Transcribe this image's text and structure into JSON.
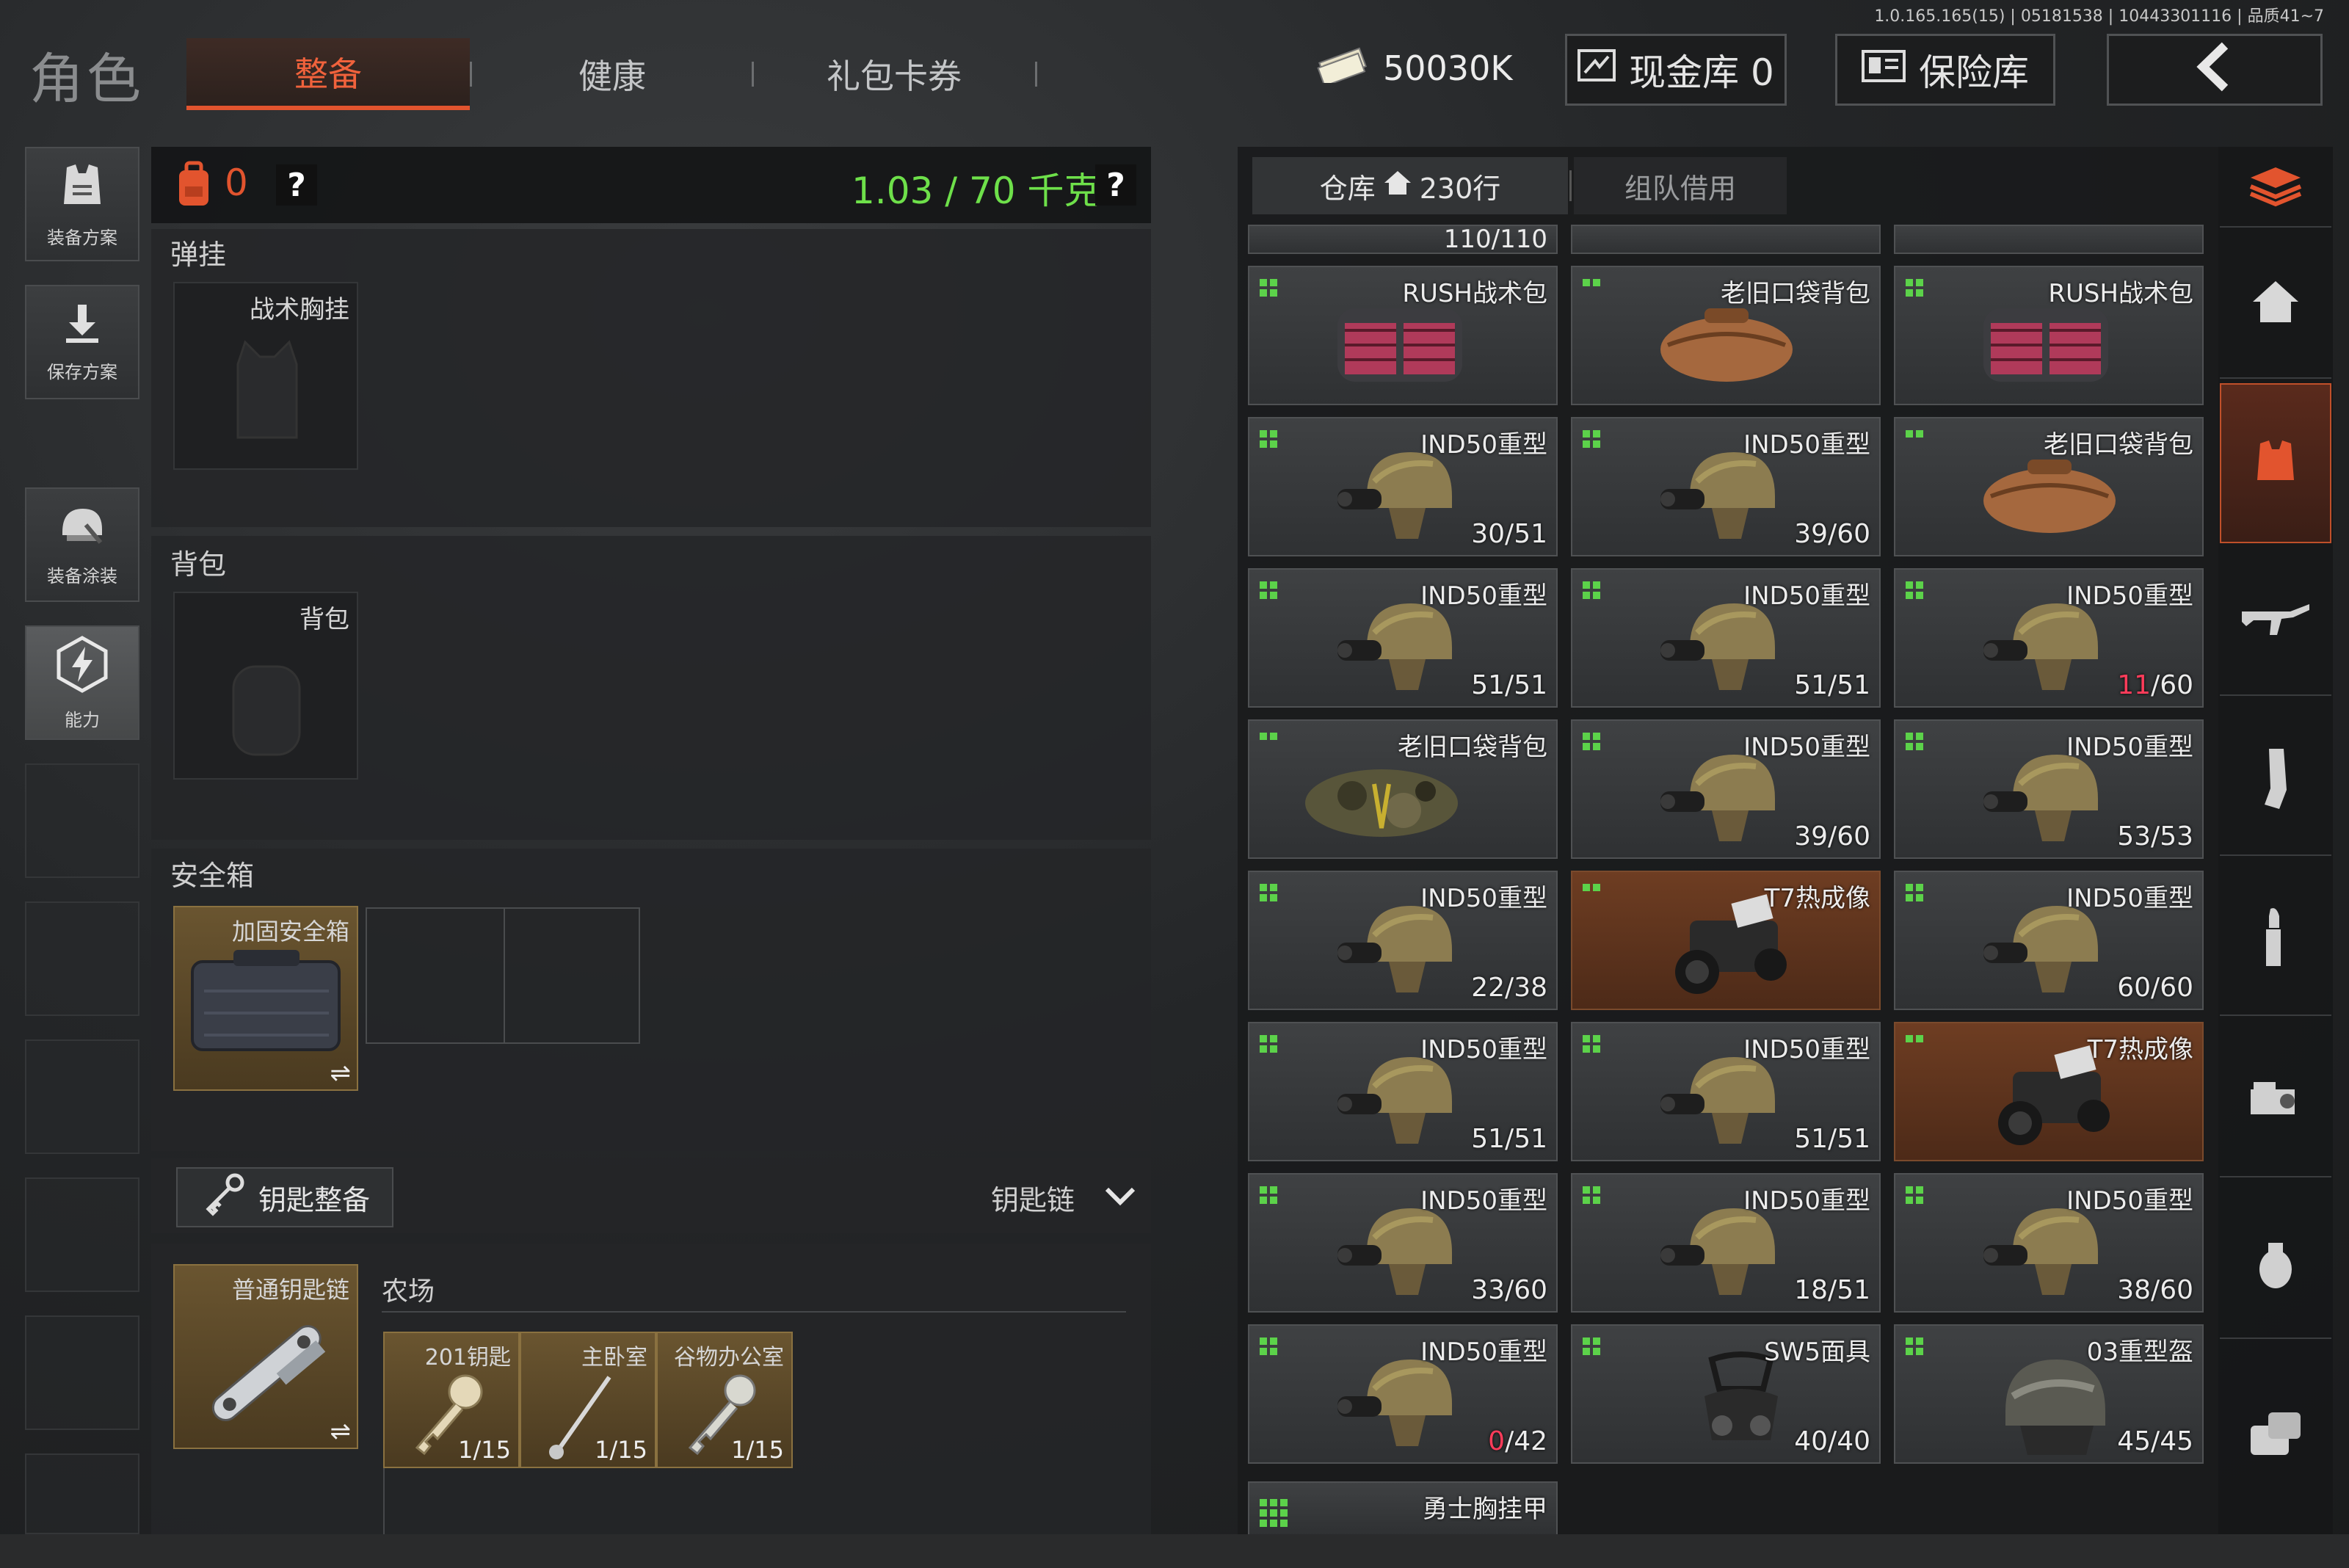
{
  "version": "1.0.165.165(15) | 05181538 | 10443301116 | 品质41~7",
  "header": {
    "title": "角色",
    "tabs": [
      {
        "label": "整备",
        "active": true
      },
      {
        "label": "健康",
        "active": false
      },
      {
        "label": "礼包卡券",
        "active": false
      }
    ],
    "money": "50030K",
    "cash_vault": "现金库 0",
    "safe_vault": "保险库",
    "back": "‹"
  },
  "sidebar": {
    "items": [
      {
        "label": "装备方案",
        "icon": "vest-icon"
      },
      {
        "label": "保存方案",
        "icon": "download-icon"
      },
      {
        "label": "装备涂装",
        "icon": "helmet-paint-icon"
      },
      {
        "label": "能力",
        "icon": "ability-icon"
      }
    ]
  },
  "loadout": {
    "backpack_count": "0",
    "help": "?",
    "weight": "1.03 / 70 千克",
    "weight_help": "?",
    "chest_rig": {
      "section": "弹挂",
      "slot_label": "战术胸挂"
    },
    "backpack": {
      "section": "背包",
      "slot_label": "背包"
    },
    "safebox": {
      "section": "安全箱",
      "item": "加固安全箱",
      "swap": "⇌"
    },
    "keys": {
      "button": "钥匙整备",
      "dropdown": "钥匙链",
      "chain_item": "普通钥匙链",
      "swap": "⇌",
      "area": "农场",
      "key_items": [
        {
          "name": "201钥匙",
          "count": "1/15"
        },
        {
          "name": "主卧室",
          "count": "1/15"
        },
        {
          "name": "谷物办公室",
          "count": "1/15"
        }
      ]
    }
  },
  "warehouse": {
    "tab_main": "仓库",
    "rows": "230行",
    "tab_team": "组队借用",
    "top_partial_count": "110/110",
    "items": [
      {
        "name": "RUSH战术包",
        "count": "",
        "type": "rush",
        "bg": "gray"
      },
      {
        "name": "老旧口袋背包",
        "count": "",
        "type": "duffel",
        "bg": "gray"
      },
      {
        "name": "RUSH战术包",
        "count": "",
        "type": "rush",
        "bg": "gray"
      },
      {
        "name": "IND50重型",
        "count": "30/51",
        "type": "helmet",
        "bg": "gray"
      },
      {
        "name": "IND50重型",
        "count": "39/60",
        "type": "helmet",
        "bg": "gray"
      },
      {
        "name": "老旧口袋背包",
        "count": "",
        "type": "duffel",
        "bg": "gray"
      },
      {
        "name": "IND50重型",
        "count": "51/51",
        "type": "helmet",
        "bg": "gray"
      },
      {
        "name": "IND50重型",
        "count": "51/51",
        "type": "helmet",
        "bg": "gray"
      },
      {
        "name": "IND50重型",
        "count": "/60",
        "count_red": "11",
        "type": "helmet",
        "bg": "gray"
      },
      {
        "name": "老旧口袋背包",
        "count": "",
        "type": "camo",
        "bg": "gray"
      },
      {
        "name": "IND50重型",
        "count": "39/60",
        "type": "helmet",
        "bg": "gray"
      },
      {
        "name": "IND50重型",
        "count": "53/53",
        "type": "helmet",
        "bg": "gray"
      },
      {
        "name": "IND50重型",
        "count": "22/38",
        "type": "helmet",
        "bg": "gray"
      },
      {
        "name": "T7热成像",
        "count": "",
        "type": "nvg",
        "bg": "orange"
      },
      {
        "name": "IND50重型",
        "count": "60/60",
        "type": "helmet",
        "bg": "gray"
      },
      {
        "name": "IND50重型",
        "count": "51/51",
        "type": "helmet",
        "bg": "gray"
      },
      {
        "name": "IND50重型",
        "count": "51/51",
        "type": "helmet",
        "bg": "gray"
      },
      {
        "name": "T7热成像",
        "count": "",
        "type": "nvg",
        "bg": "orange"
      },
      {
        "name": "IND50重型",
        "count": "33/60",
        "type": "helmet",
        "bg": "gray"
      },
      {
        "name": "IND50重型",
        "count": "18/51",
        "type": "helmet",
        "bg": "gray"
      },
      {
        "name": "IND50重型",
        "count": "38/60",
        "type": "helmet",
        "bg": "gray"
      },
      {
        "name": "IND50重型",
        "count": "/42",
        "count_red": "0",
        "type": "helmet",
        "bg": "gray"
      },
      {
        "name": "SW5面具",
        "count": "40/40",
        "type": "mask",
        "bg": "gray"
      },
      {
        "name": "03重型盔",
        "count": "45/45",
        "type": "helmet03",
        "bg": "gray"
      }
    ],
    "bottom_partial": "勇士胸挂甲"
  },
  "rail": {
    "icons": [
      "stack-icon",
      "home-icon",
      "gear-vest-icon",
      "rifle-icon",
      "magazine-icon",
      "ammo-icon",
      "scope-icon",
      "grenade-icon",
      "medkit-icon"
    ]
  },
  "colors": {
    "accent": "#e2542e",
    "weight_green": "#6ee04a",
    "pip_green": "#5cd24a",
    "red_count": "#ff3c5a"
  }
}
